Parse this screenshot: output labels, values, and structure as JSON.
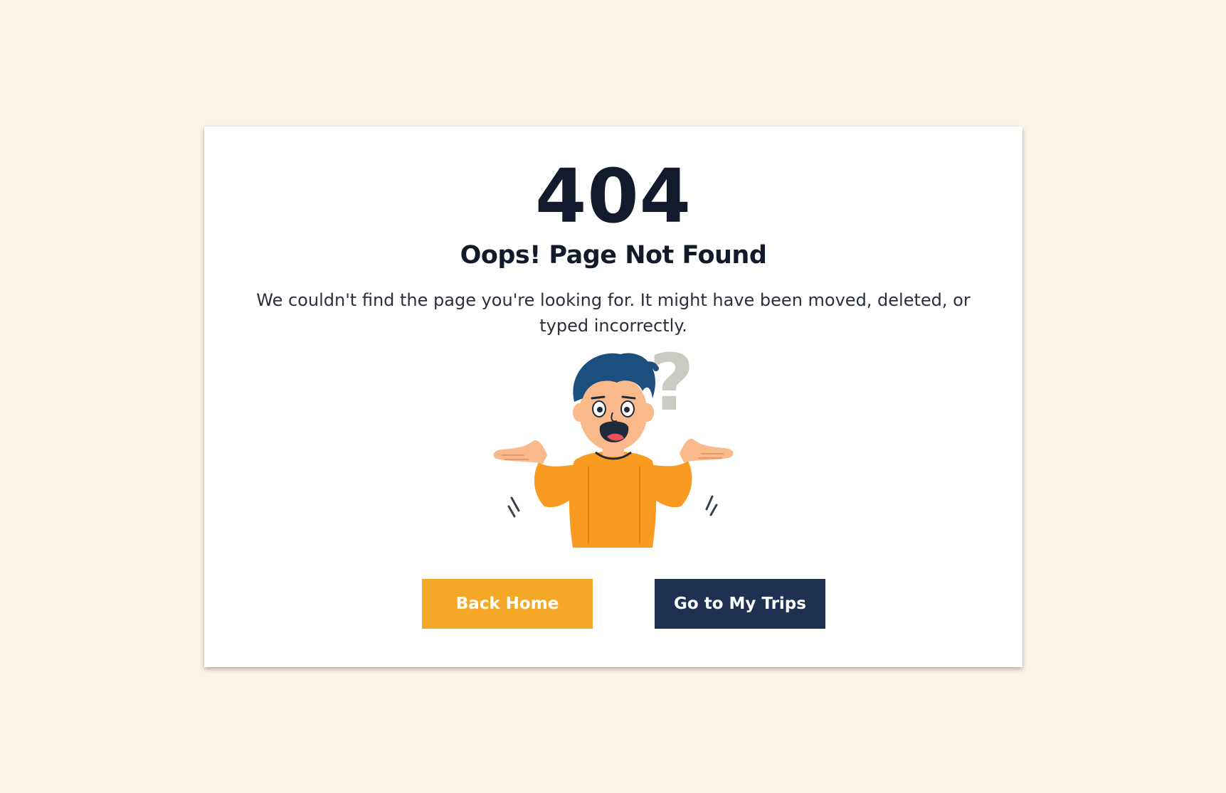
{
  "error": {
    "code": "404",
    "title": "Oops! Page Not Found",
    "message": "We couldn't find the page you're looking for. It might have been moved, deleted, or typed incorrectly."
  },
  "illustration": {
    "icon": "confused-person-icon",
    "question_mark": "?"
  },
  "actions": {
    "back_home_label": "Back Home",
    "my_trips_label": "Go to My Trips"
  },
  "colors": {
    "background": "#fbf2e8",
    "card": "#ffffff",
    "heading": "#121a2c",
    "primary_button": "#f5a727",
    "secondary_button": "#1f3153",
    "shirt": "#f89b20",
    "hair": "#1c4f7d",
    "skin": "#f9b98b"
  }
}
